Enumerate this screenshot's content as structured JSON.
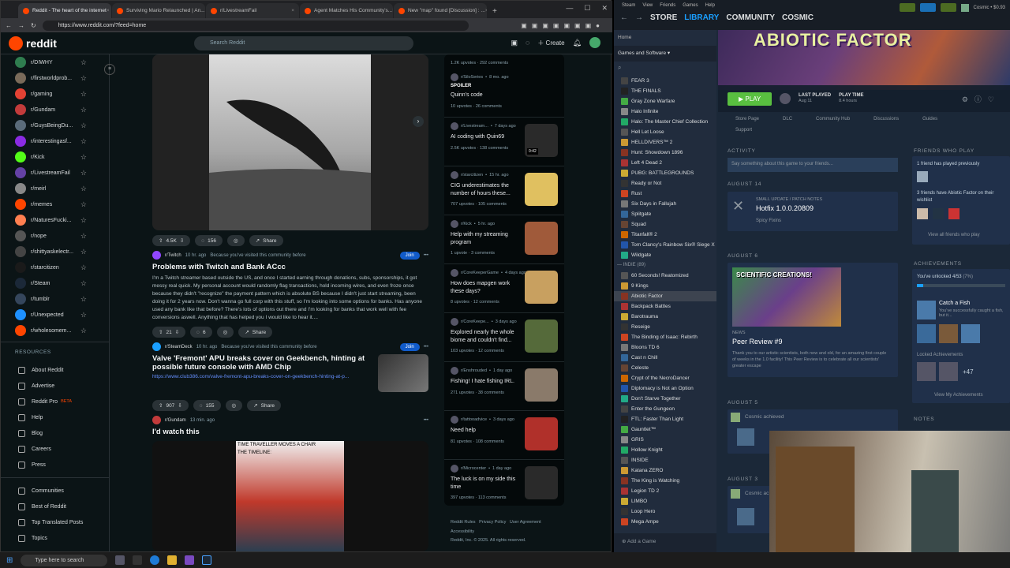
{
  "browser": {
    "tabs": [
      "Reddit - The heart of the internet",
      "Surviving Mario Relaunched | An...",
      "r/LivestreamFail",
      "Agent Matches His Community's...",
      "New \"map\" found [Discussion] : ..."
    ],
    "url": "https://www.reddit.com/?feed=home"
  },
  "reddit": {
    "logo": "reddit",
    "search_placeholder": "Search Reddit",
    "create_label": "Create",
    "subreddits": [
      "r/DIWHY",
      "r/firstworldprob...",
      "r/gaming",
      "r/Gundam",
      "r/GuysBeingDu...",
      "r/interestingasf...",
      "r/Kick",
      "r/LivestreamFail",
      "r/meirl",
      "r/memes",
      "r/NaturesFucki...",
      "r/nope",
      "r/shittyaskelectr...",
      "r/starcitizen",
      "r/Steam",
      "r/tumblr",
      "r/Unexpected",
      "r/wholesomem..."
    ],
    "sub_colors": [
      "#2f7d4f",
      "#7a6b5a",
      "#e34234",
      "#c23b3b",
      "#5a6b7a",
      "#8a2be2",
      "#53fc18",
      "#6441a5",
      "#888888",
      "#ff4500",
      "#ff7f50",
      "#555555",
      "#444444",
      "#1a1a1a",
      "#1b2838",
      "#35465c",
      "#1e90ff",
      "#ff4500"
    ],
    "resources_header": "RESOURCES",
    "resources": [
      "About Reddit",
      "Advertise",
      "Reddit Pro",
      "Help",
      "Blog",
      "Careers",
      "Press"
    ],
    "pro_badge": "BETA",
    "footer_links": [
      "Communities",
      "Best of Reddit",
      "Top Translated Posts",
      "Topics"
    ],
    "post1": {
      "votes": "4.5K",
      "comments": "156",
      "share": "Share"
    },
    "post2": {
      "sub": "r/Twitch",
      "time": "10 hr. ago",
      "reason": "Because you've visited this community before",
      "join": "Join",
      "title": "Problems with Twitch and Bank ACcc",
      "body": "I'm a Twitch streamer based outside the US, and once I started earning through donations, subs, sponsorships, it got messy real quick. My personal account would randomly flag transactions, hold incoming wires, and even froze once because they didn't \"recognize\" the payment pattern which is absolute BS because I didn't just start streaming, been doing it for 2 years now. Don't wanna go full corp with this stuff, so I'm looking into some options for banks. Has anyone used any bank like that before? There's lots of options out there and I'm looking for banks that work well with fee conversions aswell. Anything that has helped you I would like to hear it....",
      "votes": "21",
      "comments": "6",
      "share": "Share"
    },
    "post3": {
      "sub": "r/SteamDeck",
      "time": "10 hr. ago",
      "reason": "Because you've visited this community before",
      "join": "Join",
      "title": "Valve 'Fremont' APU breaks cover on Geekbench, hinting at possible future console with AMD Chip",
      "link": "https://www.club386.com/valve-fremont-apu-breaks-cover-on-geekbench-hinting-at-p...",
      "votes": "907",
      "comments": "155",
      "share": "Share"
    },
    "post4": {
      "sub": "r/Gundam",
      "time": "13 min. ago",
      "title": "I'd watch this",
      "caption1": "TIME TRAVELLER MOVES A CHAIR",
      "caption2": "THE TIMELINE:"
    },
    "right_posts": [
      {
        "sub": "r/SiloSeries",
        "time": "8 mo. ago",
        "spoiler": "SPOILER",
        "title": "Quinn's code",
        "up": "10 upvotes",
        "com": "26 comments"
      },
      {
        "sub": "r/Livestream...",
        "time": "7 days ago",
        "title": "AI coding with Quin69",
        "up": "2.5K upvotes",
        "com": "138 comments",
        "dur": "0:42"
      },
      {
        "sub": "r/starcitizen",
        "time": "15 hr. ago",
        "title": "CIG underestimates the number of hours these...",
        "up": "707 upvotes",
        "com": "105 comments"
      },
      {
        "sub": "r/Kick",
        "time": "5 hr. ago",
        "title": "Help with my streaming program",
        "up": "1 upvote",
        "com": "3 comments"
      },
      {
        "sub": "r/CoreKeeperGame",
        "time": "4 days ago",
        "title": "How does mapgen work these days?",
        "up": "8 upvotes",
        "com": "12 comments"
      },
      {
        "sub": "r/CoreKeepe...",
        "time": "3 days ago",
        "title": "Explored nearly the whole biome and couldn't find...",
        "up": "103 upvotes",
        "com": "12 comments"
      },
      {
        "sub": "r/Enshrouded",
        "time": "1 day ago",
        "title": "Fishing! I hate fishing IRL.",
        "up": "271 upvotes",
        "com": "38 comments"
      },
      {
        "sub": "r/tattooadvice",
        "time": "3 days ago",
        "title": "Need help",
        "up": "81 upvotes",
        "com": "108 comments"
      },
      {
        "sub": "r/Microcenter",
        "time": "1 day ago",
        "title": "The luck is on my side this time",
        "up": "397 upvotes",
        "com": "113 comments"
      }
    ],
    "right_footer": [
      "Reddit Rules",
      "Privacy Policy",
      "User Agreement",
      "Accessibility",
      "Reddit, Inc. © 2025. All rights reserved."
    ]
  },
  "taskbar": {
    "search": "Type here to search"
  },
  "steam": {
    "menu": [
      "Steam",
      "View",
      "Friends",
      "Games",
      "Help"
    ],
    "tabs": [
      "STORE",
      "LIBRARY",
      "COMMUNITY",
      "COSMIC"
    ],
    "user": "Cosmic • $0.93",
    "home": "Home",
    "filter": "Games and Software",
    "games": [
      "FEAR 3",
      "THE FINALS",
      "Gray Zone Warfare",
      "Halo Infinite",
      "Halo: The Master Chief Collection",
      "Hell Let Loose",
      "HELLDIVERS™ 2",
      "Hunt: Showdown 1896",
      "Left 4 Dead 2",
      "PUBG: BATTLEGROUNDS",
      "Ready or Not",
      "Rust",
      "Six Days in Fallujah",
      "Splitgate",
      "Squad",
      "Titanfall® 2",
      "Tom Clancy's Rainbow Six® Siege X",
      "Wildgate"
    ],
    "indie_label": "INDIE",
    "indie_count": "(89)",
    "indie_games": [
      "60 Seconds! Reatomized",
      "9 Kings",
      "Abiotic Factor",
      "Backpack Battles",
      "Barotrauma",
      "Reseige",
      "The Binding of Isaac: Rebirth",
      "Bloons TD 6",
      "Cast n Chill",
      "Celeste",
      "Crypt of the NecroDancer",
      "Diplomacy is Not an Option",
      "Don't Starve Together",
      "Enter the Gungeon",
      "FTL: Faster Than Light",
      "Gauntlet™",
      "GRIS",
      "Hollow Knight",
      "INSIDE",
      "Katana ZERO",
      "The King is Watching",
      "Legion TD 2",
      "LIMBO",
      "Loop Hero",
      "Mega Ampe"
    ],
    "add_game": "Add a Game",
    "game_title": "ABIOTIC FACTOR",
    "play": "PLAY",
    "last_played_label": "LAST PLAYED",
    "last_played": "Aug 11",
    "play_time_label": "PLAY TIME",
    "play_time": "8.4 hours",
    "subnav": [
      "Store Page",
      "DLC",
      "Community Hub",
      "Discussions",
      "Guides",
      "Support"
    ],
    "activity": "ACTIVITY",
    "activity_placeholder": "Say something about this game to your friends...",
    "date1": "AUGUST 14",
    "patch_label": "SMALL UPDATE / PATCH NOTES",
    "patch_title": "Hotfix 1.0.0.20809",
    "patch_sub": "Spicy Fixins",
    "date2": "AUGUST 6",
    "news_banner": "SCIENTIFIC CREATIONS!",
    "news_label": "NEWS",
    "news_title": "Peer Review #9",
    "news_body": "Thank you to our artistic scientists, both new and old, for an amazing first couple of weeks in the 1.0 facility! This Peer Review is to celebrate all our scientists' greater escape",
    "date3": "AUGUST 5",
    "achieved": "Cosmic achieved",
    "date4": "AUGUST 3",
    "achieved2": "Cosmic ac",
    "friends_header": "FRIENDS WHO PLAY",
    "friends_played": "1 friend has played previously",
    "friends_wishlist": "3 friends have Abiotic Factor on their wishlist",
    "view_friends": "View all friends who play",
    "ach_header": "ACHIEVEMENTS",
    "ach_progress": "You've unlocked 4/53",
    "ach_pct": "(7%)",
    "ach_fraction": 0.075,
    "ach_name": "Catch a Fish",
    "ach_desc": "You've successfully caught a fish, but it...",
    "locked": "Locked Achievements",
    "more": "+47",
    "view_ach": "View My Achievements",
    "notes": "NOTES"
  }
}
